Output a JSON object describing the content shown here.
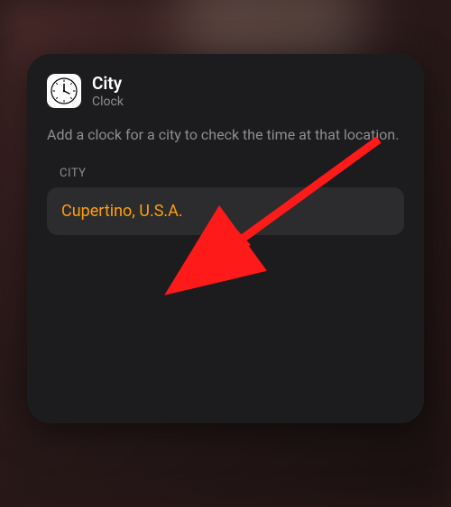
{
  "header": {
    "title": "City",
    "subtitle": "Clock",
    "icon_name": "clock-icon"
  },
  "description": "Add a clock for a city to check the time at that location.",
  "section_label": "CITY",
  "city_value": "Cupertino, U.S.A.",
  "colors": {
    "accent": "#ff9f0a"
  }
}
